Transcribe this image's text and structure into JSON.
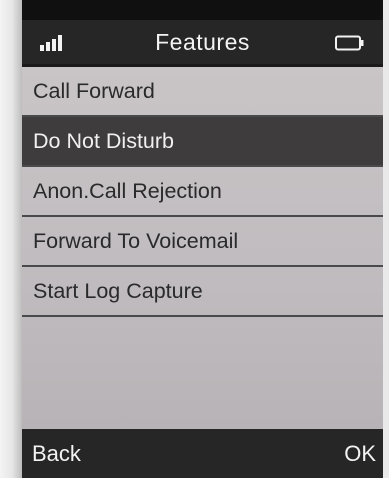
{
  "status_bar": {
    "signal_icon": "signal-bars-icon",
    "title": "Features",
    "battery_icon": "battery-icon"
  },
  "menu": {
    "selected_index": 1,
    "items": [
      {
        "label": "Call Forward"
      },
      {
        "label": "Do Not Disturb"
      },
      {
        "label": "Anon.Call Rejection"
      },
      {
        "label": "Forward To Voicemail"
      },
      {
        "label": "Start Log Capture"
      }
    ]
  },
  "softkeys": {
    "left": "Back",
    "right": "OK"
  },
  "colors": {
    "status_bar_bg": "#262626",
    "list_bg": "#c9c5c7",
    "selected_bg": "#3e3c3d",
    "text_dark": "#2a2a2a",
    "text_light": "#f3f3f3"
  }
}
